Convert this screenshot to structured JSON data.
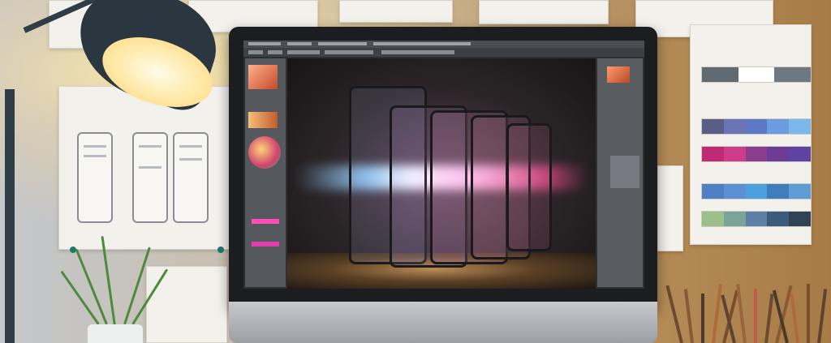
{
  "scene": {
    "description_colors": {
      "lamp_light": "#ffe9a8",
      "monitor_bezel": "#1b1d21",
      "corkboard": "#b38a55",
      "ui_panel": "#55585d"
    },
    "icons": [
      "desk-lamp-icon",
      "monitor-icon",
      "plant-icon",
      "pencil-cup-icon"
    ]
  },
  "palette_swatches": [
    [
      "#5f6a73",
      "#ffffff",
      "#6d7880"
    ],
    [
      "#5a5d86",
      "#6a73b4",
      "#5b78c4",
      "#6b9be0",
      "#7ab8ea"
    ],
    [
      "#c02a74",
      "#cf3c8a",
      "#8a3d8d",
      "#6c3d97",
      "#5f43a3"
    ],
    [
      "#4e7fc4",
      "#5a8fd3",
      "#4aa0dc",
      "#3f7dbd",
      "#5e9cd8"
    ],
    [
      "#9cc08a",
      "#7aa39a",
      "#5c7fa6",
      "#3c5a7a",
      "#2f4256"
    ]
  ]
}
